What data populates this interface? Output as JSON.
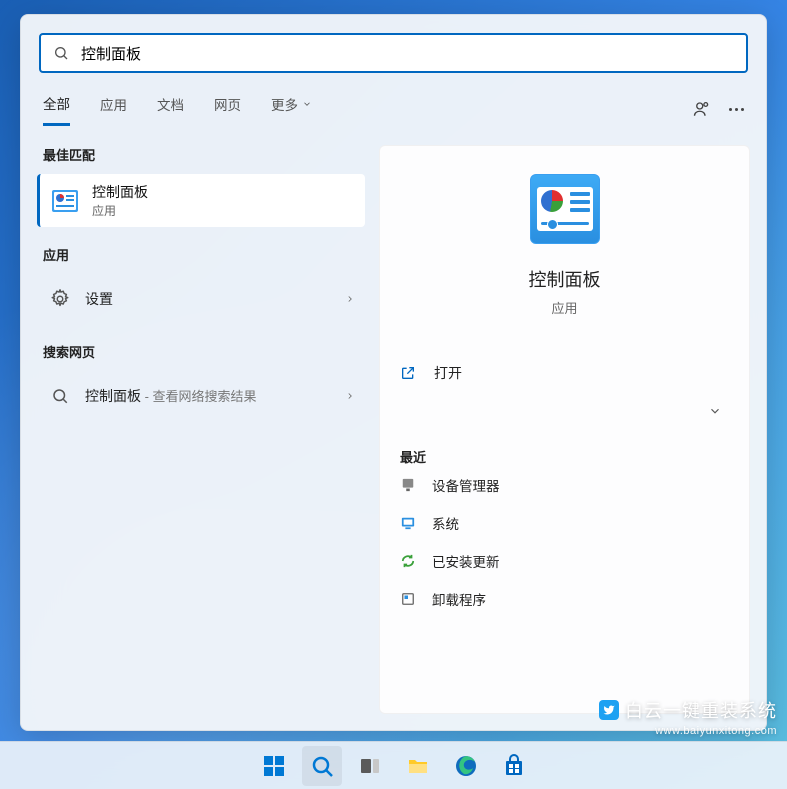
{
  "search": {
    "value": "控制面板"
  },
  "tabs": {
    "all": "全部",
    "apps": "应用",
    "docs": "文档",
    "web": "网页",
    "more": "更多"
  },
  "left": {
    "bestMatch": "最佳匹配",
    "bestItem": {
      "title": "控制面板",
      "sub": "应用"
    },
    "appsHeader": "应用",
    "settings": "设置",
    "webHeader": "搜索网页",
    "webItem": {
      "term": "控制面板",
      "hint": " - 查看网络搜索结果"
    }
  },
  "preview": {
    "title": "控制面板",
    "sub": "应用",
    "open": "打开",
    "recent": "最近",
    "items": {
      "deviceManager": "设备管理器",
      "system": "系统",
      "updates": "已安装更新",
      "uninstall": "卸载程序"
    }
  },
  "watermark": {
    "title": "白云一键重装系统",
    "sub": "www.baiyunxitong.com"
  }
}
